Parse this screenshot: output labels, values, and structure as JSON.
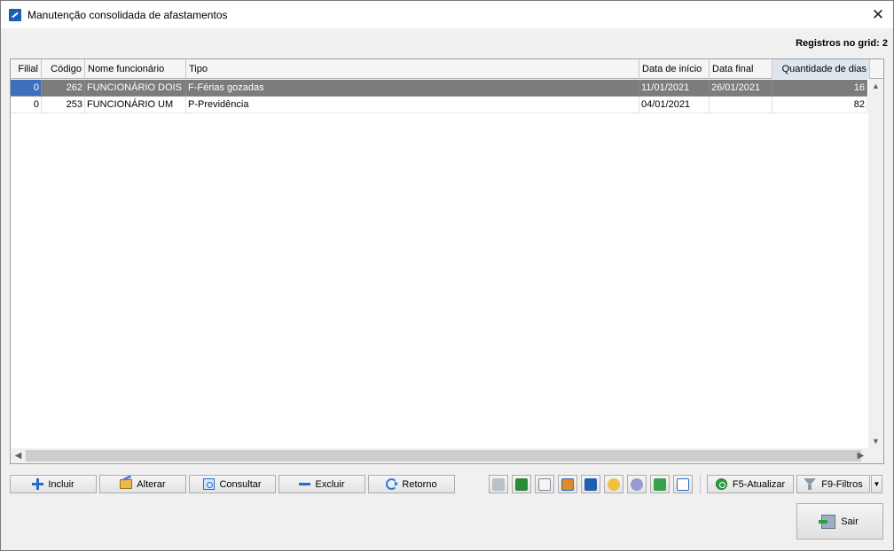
{
  "window": {
    "title": "Manutenção consolidada de afastamentos",
    "close_symbol": "✕"
  },
  "summary": {
    "registros_label": "Registros no grid: 2"
  },
  "grid": {
    "columns": [
      "Filial",
      "Código",
      "Nome funcionário",
      "Tipo",
      "Data de início",
      "Data final",
      "Quantidade de dias"
    ],
    "rows": [
      {
        "filial": "0",
        "codigo": "262",
        "nome": "FUNCIONÁRIO DOIS",
        "tipo": "F-Férias gozadas",
        "inicio": "11/01/2021",
        "final": "26/01/2021",
        "dias": "16",
        "selected": true
      },
      {
        "filial": "0",
        "codigo": "253",
        "nome": "FUNCIONÁRIO UM",
        "tipo": "P-Previdência",
        "inicio": "04/01/2021",
        "final": "",
        "dias": "82",
        "selected": false
      }
    ]
  },
  "toolbar": {
    "incluir": "Incluir",
    "alterar": "Alterar",
    "consultar": "Consultar",
    "excluir": "Excluir",
    "retorno": "Retorno",
    "atualizar": "F5-Atualizar",
    "filtros": "F9-Filtros",
    "icons": [
      "glasses-icon",
      "excel-icon",
      "document-icon",
      "image-icon",
      "sort-icon",
      "palette-icon",
      "gear-icon",
      "download-icon",
      "checklist-icon"
    ]
  },
  "footer": {
    "sair": "Sair"
  },
  "colors": {
    "selected_row": "#7c7c7c",
    "selected_cell": "#3d6fbf",
    "accent": "#1f6fd0"
  }
}
